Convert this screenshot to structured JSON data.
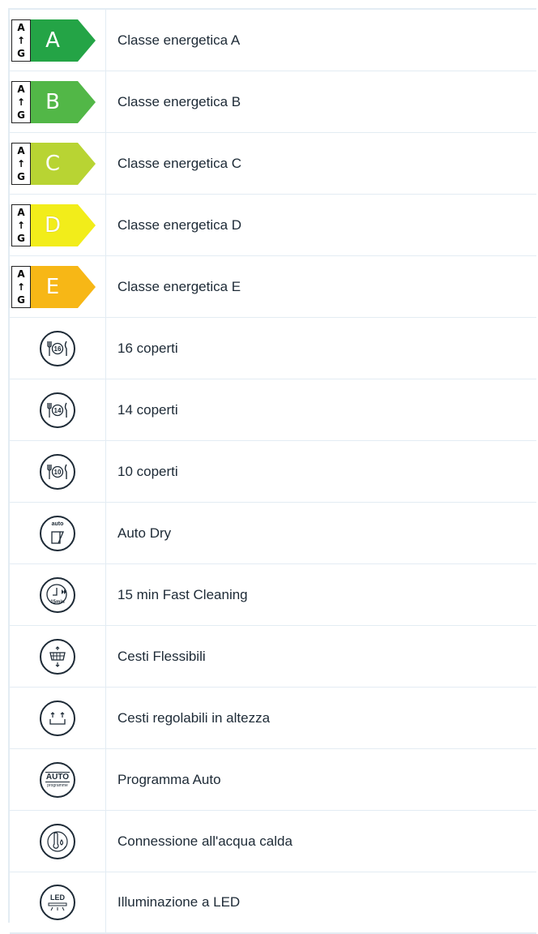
{
  "energy_classes": [
    {
      "letter": "A",
      "label": "Classe energetica A",
      "color": "#24a446"
    },
    {
      "letter": "B",
      "label": "Classe energetica B",
      "color": "#52b747"
    },
    {
      "letter": "C",
      "label": "Classe energetica C",
      "color": "#b8d433"
    },
    {
      "letter": "D",
      "label": "Classe energetica D",
      "color": "#f2ed1a"
    },
    {
      "letter": "E",
      "label": "Classe energetica E",
      "color": "#f7b716"
    }
  ],
  "scale_letters": {
    "top": "A",
    "bottom": "G"
  },
  "features": [
    {
      "icon": "cutlery-16-icon",
      "badge": "16",
      "label": "16 coperti"
    },
    {
      "icon": "cutlery-14-icon",
      "badge": "14",
      "label": "14 coperti"
    },
    {
      "icon": "cutlery-10-icon",
      "badge": "10",
      "label": "10 coperti"
    },
    {
      "icon": "auto-dry-icon",
      "badge": "auto",
      "label": "Auto Dry"
    },
    {
      "icon": "fast-clean-icon",
      "badge": "15min",
      "label": "15 min Fast Cleaning"
    },
    {
      "icon": "flexible-basket-icon",
      "label": "Cesti Flessibili"
    },
    {
      "icon": "adjustable-basket-icon",
      "label": "Cesti regolabili in altezza"
    },
    {
      "icon": "auto-program-icon",
      "badge": "AUTO",
      "sub": "programme",
      "label": "Programma Auto"
    },
    {
      "icon": "hot-water-icon",
      "label": "Connessione all'acqua calda"
    },
    {
      "icon": "led-light-icon",
      "badge": "LED",
      "label": "Illuminazione a LED"
    }
  ]
}
